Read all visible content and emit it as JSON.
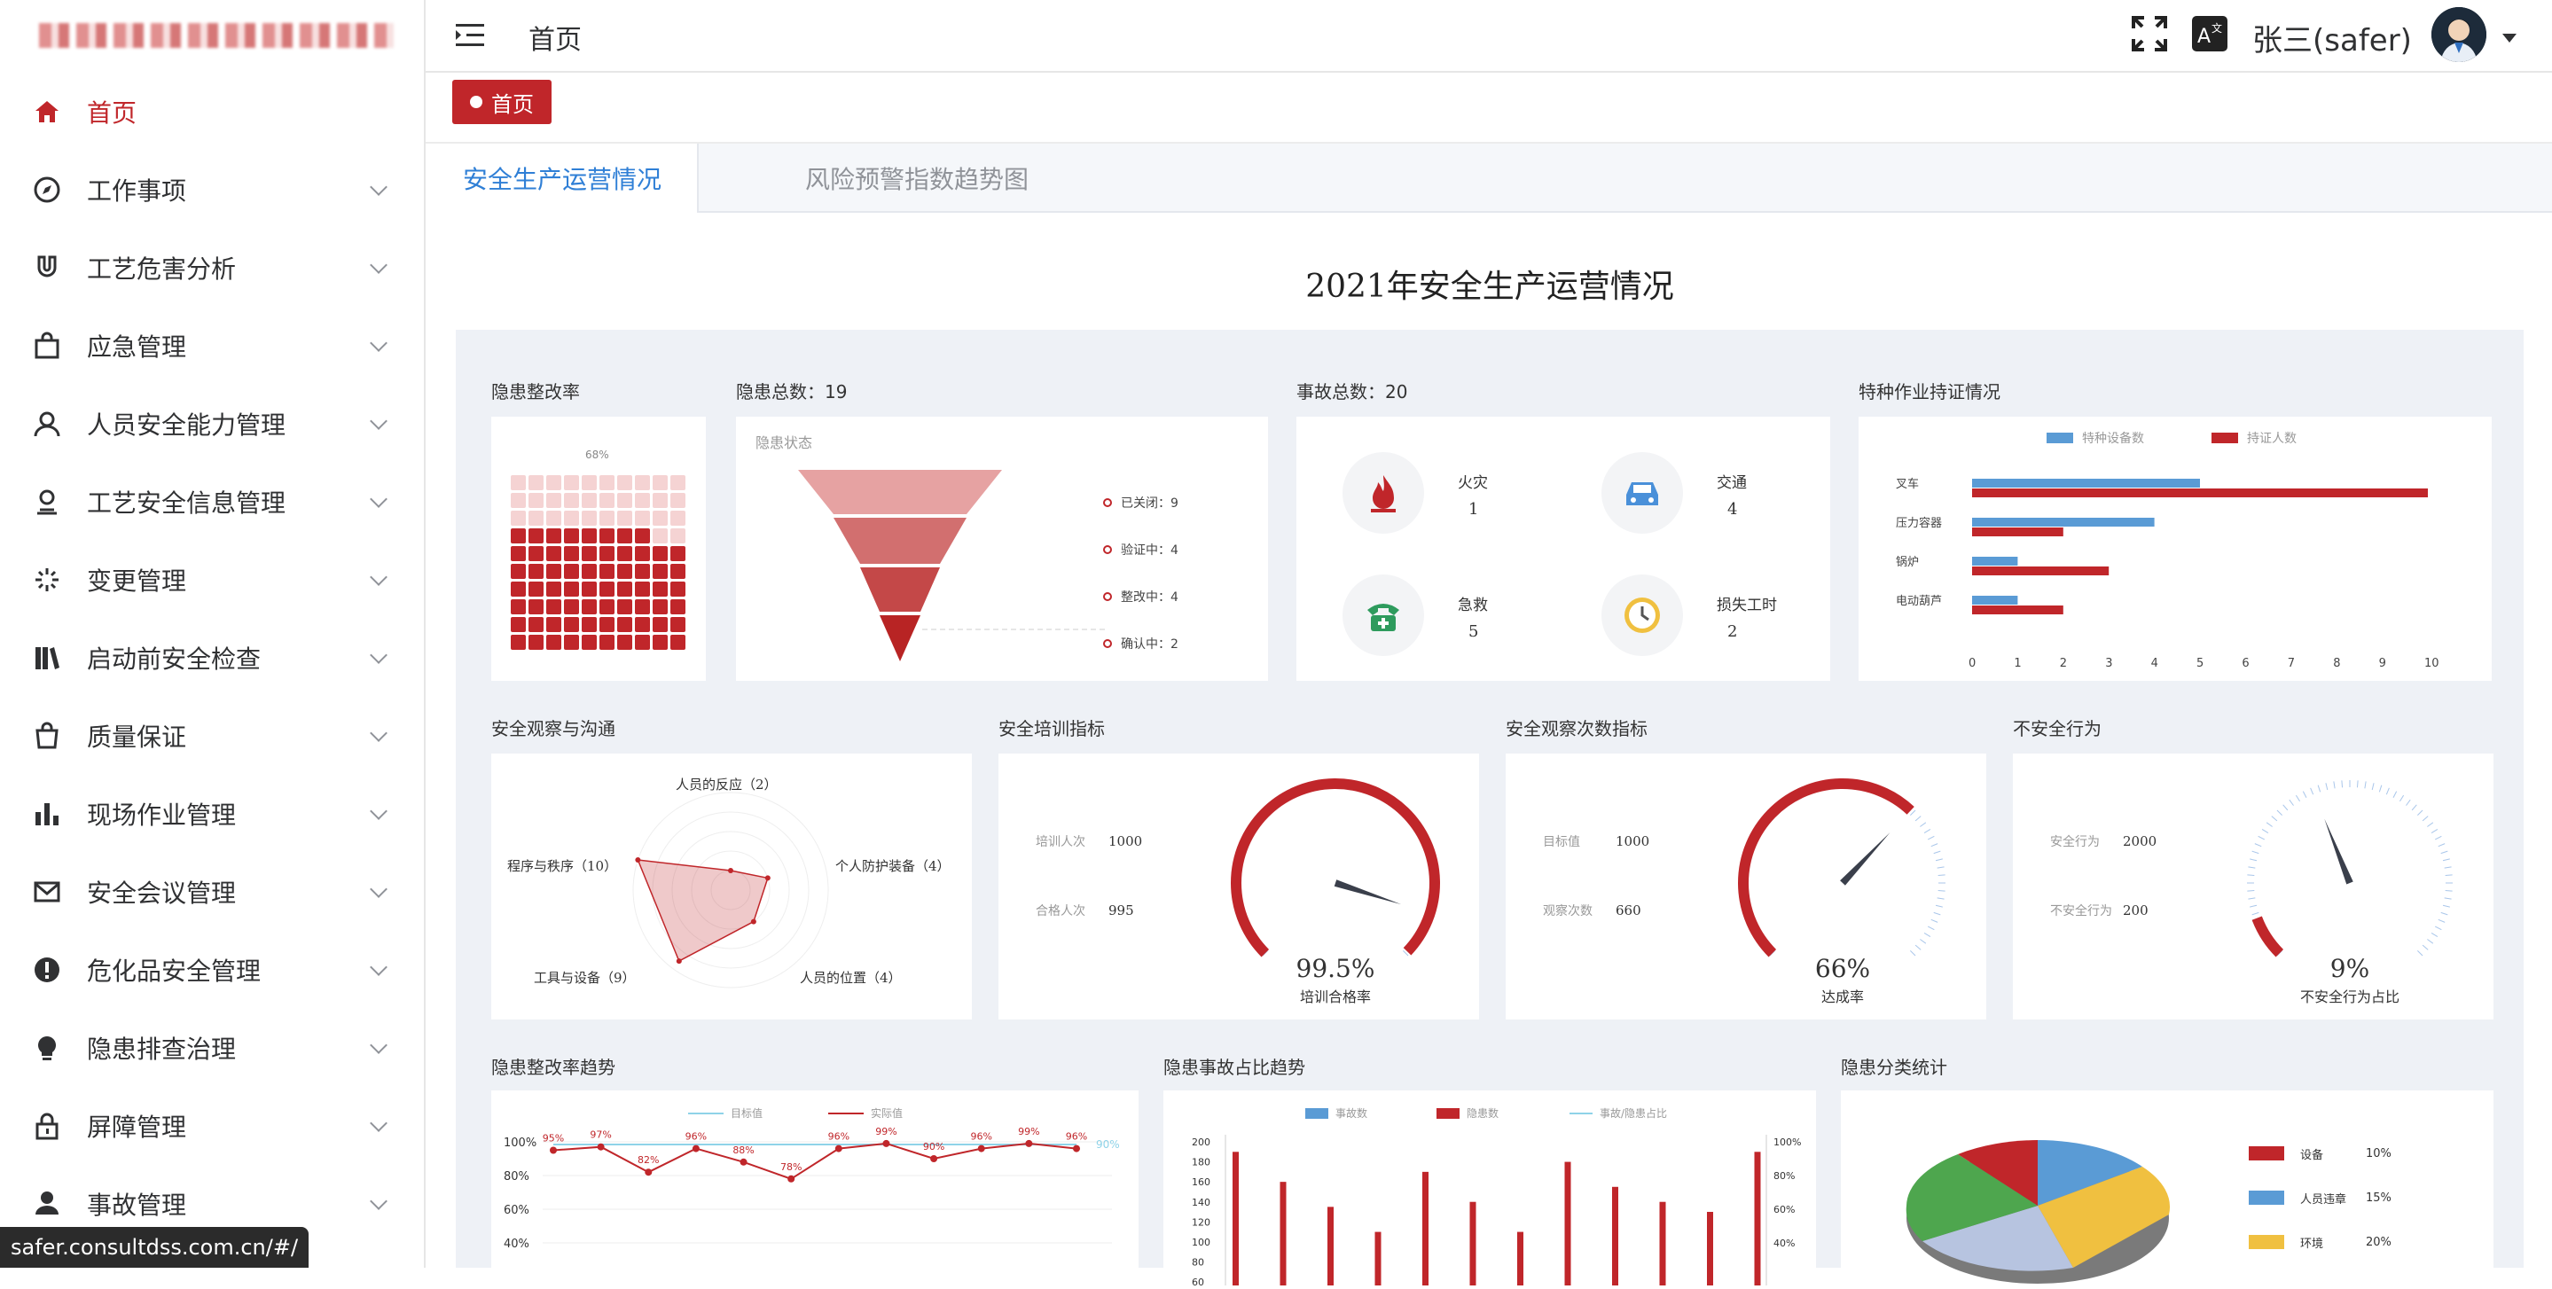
{
  "sidebar": {
    "items": [
      {
        "label": "首页",
        "icon": "home-icon",
        "active": true
      },
      {
        "label": "工作事项",
        "icon": "compass-icon"
      },
      {
        "label": "工艺危害分析",
        "icon": "magnet-icon"
      },
      {
        "label": "应急管理",
        "icon": "bag-icon"
      },
      {
        "label": "人员安全能力管理",
        "icon": "user-icon"
      },
      {
        "label": "工艺安全信息管理",
        "icon": "user-pin-icon"
      },
      {
        "label": "变更管理",
        "icon": "loading-icon"
      },
      {
        "label": "启动前安全检查",
        "icon": "books-icon"
      },
      {
        "label": "质量保证",
        "icon": "shopping-bag-icon"
      },
      {
        "label": "现场作业管理",
        "icon": "bar-chart-icon"
      },
      {
        "label": "安全会议管理",
        "icon": "mail-icon"
      },
      {
        "label": "危化品安全管理",
        "icon": "warning-circle-icon"
      },
      {
        "label": "隐患排查治理",
        "icon": "bulb-icon"
      },
      {
        "label": "屏障管理",
        "icon": "lock-icon"
      },
      {
        "label": "事故管理",
        "icon": "person-icon"
      }
    ]
  },
  "header": {
    "breadcrumb": "首页",
    "username": "张三(safer)"
  },
  "tags": {
    "home": "首页"
  },
  "tabs": [
    {
      "label": "安全生产运营情况",
      "active": true
    },
    {
      "label": "风险预警指数趋势图",
      "active": false
    }
  ],
  "dashboard": {
    "title": "2021年安全生产运营情况",
    "rect_rate": {
      "title": "隐患整改率",
      "percent_label": "68%",
      "value": 0.68
    },
    "hazard_total": {
      "title": "隐患总数：19",
      "subtitle": "隐患状态",
      "legend": [
        "已关闭：9",
        "验证中：4",
        "整改中：4",
        "确认中：2"
      ]
    },
    "accident_total": {
      "title": "事故总数：20",
      "items": [
        {
          "label": "火灾",
          "value": "1"
        },
        {
          "label": "交通",
          "value": "4"
        },
        {
          "label": "急救",
          "value": "5"
        },
        {
          "label": "损失工时",
          "value": "2"
        }
      ]
    },
    "cert": {
      "title": "特种作业持证情况",
      "legend": [
        "特种设备数",
        "持证人数"
      ]
    },
    "observation": {
      "title": "安全观察与沟通",
      "labels": [
        "人员的反应（2）",
        "个人防护装备（4）",
        "人员的位置（4）",
        "工具与设备（9）",
        "程序与秩序（10）"
      ]
    },
    "training": {
      "title": "安全培训指标",
      "row1_label": "培训人次",
      "row1_value": "1000",
      "row2_label": "合格人次",
      "row2_value": "995",
      "gauge_value": "99.5%",
      "gauge_label": "培训合格率"
    },
    "obs_count": {
      "title": "安全观察次数指标",
      "row1_label": "目标值",
      "row1_value": "1000",
      "row2_label": "观察次数",
      "row2_value": "660",
      "gauge_value": "66%",
      "gauge_label": "达成率"
    },
    "unsafe": {
      "title": "不安全行为",
      "row1_label": "安全行为",
      "row1_value": "2000",
      "row2_label": "不安全行为",
      "row2_value": "200",
      "gauge_value": "9%",
      "gauge_label": "不安全行为占比"
    },
    "trend": {
      "title": "隐患整改率趋势",
      "legend": [
        "目标值",
        "实际值"
      ],
      "target_label": "90%"
    },
    "ratio": {
      "title": "隐患事故占比趋势",
      "legend": [
        "事故数",
        "隐患数",
        "事故/隐患占比"
      ]
    },
    "category": {
      "title": "隐患分类统计",
      "legend": [
        {
          "name": "设备",
          "pct": "10%",
          "color": "#c0262a"
        },
        {
          "name": "人员违章",
          "pct": "15%",
          "color": "#5a9bd5"
        },
        {
          "name": "环境",
          "pct": "20%",
          "color": "#f0c040"
        }
      ]
    }
  },
  "chart_data": [
    {
      "type": "bar",
      "title": "特种作业持证情况",
      "categories": [
        "叉车",
        "压力容器",
        "锅炉",
        "电动葫芦"
      ],
      "series": [
        {
          "name": "特种设备数",
          "values": [
            5,
            4,
            1,
            1
          ]
        },
        {
          "name": "持证人数",
          "values": [
            10,
            2,
            3,
            2
          ]
        }
      ],
      "xlim": [
        0,
        10
      ],
      "xticks": [
        "0",
        "1",
        "2",
        "3",
        "4",
        "5",
        "6",
        "7",
        "8",
        "9",
        "10"
      ]
    },
    {
      "type": "line",
      "title": "隐患整改率趋势",
      "series": [
        {
          "name": "实际值",
          "values": [
            95,
            97,
            82,
            96,
            88,
            78,
            96,
            99,
            90,
            96,
            99,
            96
          ]
        },
        {
          "name": "目标值",
          "values": [
            90,
            90,
            90,
            90,
            90,
            90,
            90,
            90,
            90,
            90,
            90,
            90
          ]
        }
      ],
      "data_labels": [
        "95%",
        "97%",
        "82%",
        "96%",
        "88%",
        "78%",
        "96%",
        "99%",
        "90%",
        "96%",
        "99%",
        "96%"
      ],
      "yticks": [
        "100%",
        "80%",
        "60%",
        "40%"
      ]
    },
    {
      "type": "bar",
      "title": "隐患事故占比趋势",
      "yticks_left": [
        "200",
        "180",
        "160",
        "140",
        "120",
        "100",
        "80",
        "60"
      ],
      "yticks_right": [
        "100%",
        "80%",
        "60%",
        "40%"
      ],
      "series": [
        {
          "name": "隐患数",
          "values": [
            190,
            160,
            135,
            110,
            170,
            140,
            110,
            180,
            155,
            140,
            130,
            190
          ]
        }
      ]
    }
  ],
  "status_url": "safer.consultdss.com.cn/#/"
}
